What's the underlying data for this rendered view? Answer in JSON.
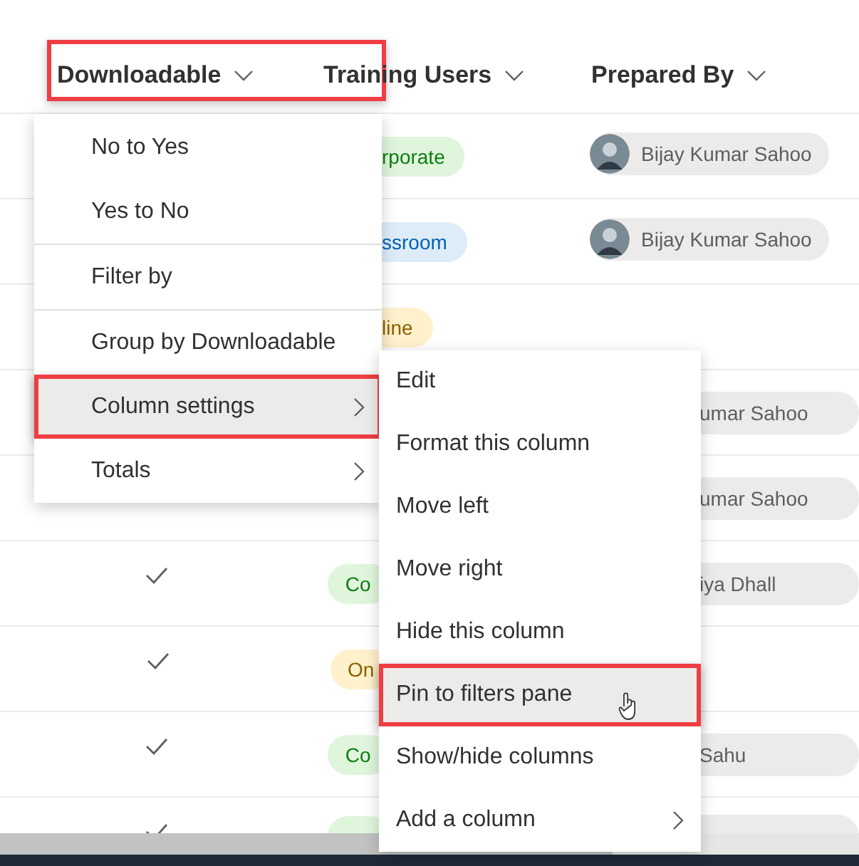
{
  "columns": [
    {
      "label": "Downloadable",
      "annotated": true
    },
    {
      "label": "Training Users",
      "annotated": false
    },
    {
      "label": "Prepared By",
      "annotated": false
    }
  ],
  "rows": [
    {
      "check": false,
      "tag": {
        "text": "rporate",
        "color": "#dff6dd",
        "partly_hidden": true
      },
      "person": {
        "name": "Bijay Kumar Sahoo",
        "avatar": true,
        "partly_hidden": false
      }
    },
    {
      "check": false,
      "tag": {
        "text": "ssroom",
        "color": "#deecf9",
        "partly_hidden": true
      },
      "person": {
        "name": "Bijay Kumar Sahoo",
        "avatar": true,
        "partly_hidden": false
      }
    },
    {
      "check": false,
      "tag": {
        "text": "line",
        "color": "#fff1cc",
        "partly_hidden": true
      }
    },
    {
      "check": false,
      "person": {
        "name": "umar Sahoo",
        "avatar": false,
        "partly_hidden": true
      }
    },
    {
      "check": false,
      "person": {
        "name": "umar Sahoo",
        "avatar": false,
        "partly_hidden": true
      }
    },
    {
      "check": true,
      "tag": {
        "text": "Co",
        "color": "#dff6dd",
        "partly_hidden": false
      },
      "person": {
        "name": "iya Dhall",
        "avatar": false,
        "partly_hidden": true
      }
    },
    {
      "check": true,
      "tag": {
        "text": "On",
        "color": "#fff1cc",
        "partly_hidden": false
      }
    },
    {
      "check": true,
      "tag": {
        "text": "Co",
        "color": "#dff6dd",
        "partly_hidden": false
      },
      "person": {
        "name": "Sahu",
        "avatar": false,
        "partly_hidden": true
      }
    },
    {
      "check": true,
      "tag": {
        "color": "#dff6dd",
        "partly_hidden": false
      },
      "person": {
        "avatar": false,
        "partly_hidden": true
      }
    }
  ],
  "column_menu": [
    {
      "kind": "item",
      "label": "No to Yes",
      "selected": false,
      "annotated": false
    },
    {
      "kind": "item",
      "label": "Yes to No",
      "selected": false,
      "annotated": false
    },
    {
      "kind": "divider"
    },
    {
      "kind": "item",
      "label": "Filter by",
      "selected": false,
      "annotated": false
    },
    {
      "kind": "divider"
    },
    {
      "kind": "item",
      "label": "Group by Downloadable",
      "selected": false,
      "annotated": false
    },
    {
      "kind": "submenu",
      "label": "Column settings",
      "selected": true,
      "annotated": true
    },
    {
      "kind": "submenu",
      "label": "Totals",
      "selected": false,
      "annotated": false
    }
  ],
  "settings_menu": [
    {
      "kind": "item",
      "label": "Edit",
      "selected": false,
      "annotated": false
    },
    {
      "kind": "item",
      "label": "Format this column",
      "selected": false,
      "annotated": false
    },
    {
      "kind": "item",
      "label": "Move left",
      "selected": false,
      "annotated": false
    },
    {
      "kind": "item",
      "label": "Move right",
      "selected": false,
      "annotated": false
    },
    {
      "kind": "item",
      "label": "Hide this column",
      "selected": false,
      "annotated": false
    },
    {
      "kind": "item",
      "label": "Pin to filters pane",
      "selected": true,
      "annotated": true,
      "cursor": true
    },
    {
      "kind": "item",
      "label": "Show/hide columns",
      "selected": false,
      "annotated": false
    },
    {
      "kind": "submenu",
      "label": "Add a column",
      "selected": false,
      "annotated": false
    }
  ]
}
